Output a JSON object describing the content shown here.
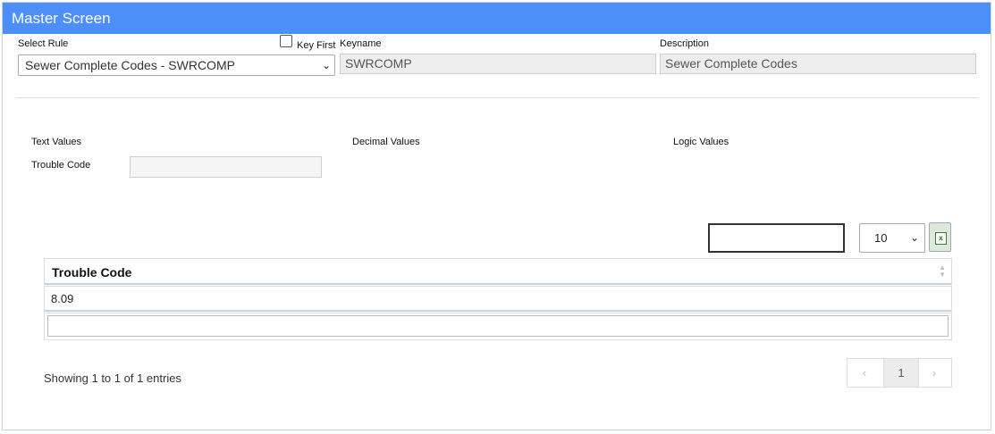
{
  "titlebar": {
    "title": "Master Screen"
  },
  "rule": {
    "select_label": "Select Rule",
    "selected_value": "Sewer Complete Codes - SWRCOMP",
    "key_first_label": "Key First",
    "keyname_label": "Keyname",
    "keyname_value": "SWRCOMP",
    "description_label": "Description",
    "description_value": "Sewer Complete Codes"
  },
  "values": {
    "text_values_label": "Text Values",
    "decimal_values_label": "Decimal Values",
    "logic_values_label": "Logic Values",
    "trouble_code_label": "Trouble Code",
    "trouble_code_value": ""
  },
  "grid": {
    "search_value": "",
    "page_size": "10",
    "excel_icon": "excel-export-icon",
    "columns": [
      "Trouble Code"
    ],
    "rows": [
      [
        "8.09"
      ]
    ],
    "filter_value": "",
    "info": "Showing 1 to 1 of 1 entries",
    "pagination": {
      "prev": "‹",
      "current": "1",
      "next": "›"
    }
  },
  "colors": {
    "header": "#4d8ff8",
    "accent_border": "#c7d4e6"
  }
}
